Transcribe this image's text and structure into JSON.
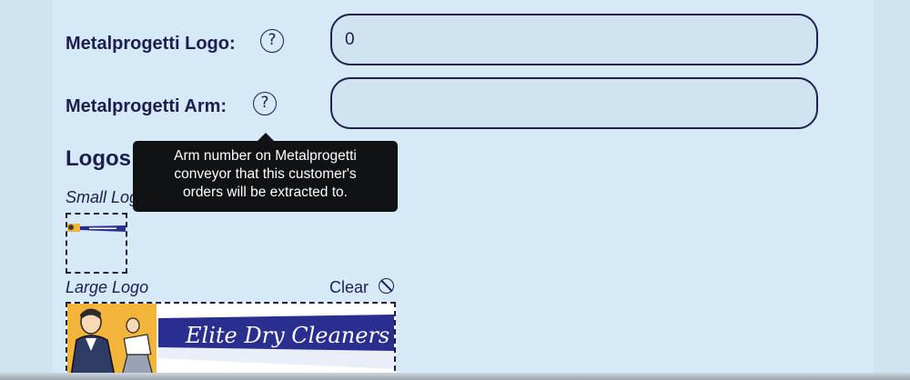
{
  "form": {
    "logo_field": {
      "label": "Metalprogetti Logo:",
      "value": "0"
    },
    "arm_field": {
      "label": "Metalprogetti Arm:",
      "value": ""
    },
    "help_glyph": "?"
  },
  "tooltip": {
    "lines": [
      "Arm number on Metalprogetti",
      "conveyor that this customer's",
      "orders will be extracted to."
    ]
  },
  "logos": {
    "title": "Logos",
    "small_logo_label": "Small Logo",
    "large_logo_label": "Large Logo",
    "clear_label": "Clear",
    "large_logo_text": "Elite Dry Cleaners"
  },
  "colors": {
    "accent": "#1d1e4e",
    "banner_blue": "#2a2f8f",
    "banner_yellow": "#f2b53a"
  }
}
